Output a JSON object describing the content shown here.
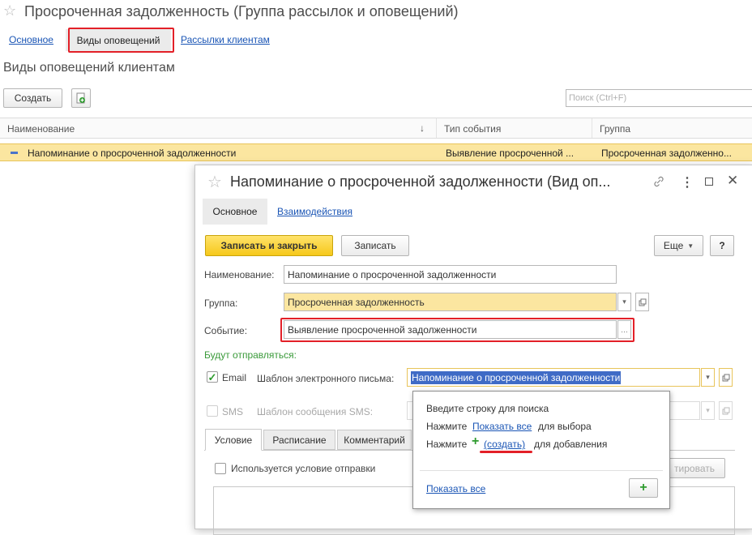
{
  "main": {
    "title": "Просроченная задолженность (Группа рассылок и оповещений)",
    "tabs": [
      "Основное",
      "Виды оповещений",
      "Рассылки клиентам"
    ],
    "section_title": "Виды оповещений клиентам",
    "create_label": "Создать",
    "search_placeholder": "Поиск (Ctrl+F)",
    "columns": [
      "Наименование",
      "Тип события",
      "Группа"
    ],
    "sort_indicator": "↓",
    "rows": [
      {
        "name": "Напоминание о просроченной задолженности",
        "event": "Выявление просроченной ...",
        "group": "Просроченная задолженно..."
      }
    ]
  },
  "dialog": {
    "title": "Напоминание о просроченной задолженности (Вид оп...",
    "tabs": [
      "Основное",
      "Взаимодействия"
    ],
    "save_close_label": "Записать и закрыть",
    "save_label": "Записать",
    "more_label": "Еще",
    "help_label": "?",
    "name_label": "Наименование:",
    "name_value": "Напоминание о просроченной задолженности",
    "group_label": "Группа:",
    "group_value": "Просроченная задолженность",
    "event_label": "Событие:",
    "event_value": "Выявление просроченной задолженности",
    "will_send_label": "Будут отправляться:",
    "email_label": "Email",
    "email_template_label": "Шаблон электронного письма:",
    "email_template_value": "Напоминание о просроченной задолженности",
    "sms_label": "SMS",
    "sms_template_label": "Шаблон сообщения SMS:",
    "inner_tabs": [
      "Условие",
      "Расписание",
      "Комментарий"
    ],
    "condition_label": "Используется условие отправки",
    "edit_button_partial": "тировать"
  },
  "popup": {
    "line1": "Введите строку для поиска",
    "line2_prefix": "Нажмите",
    "line2_link": "Показать все",
    "line2_suffix": "для выбора",
    "line3_prefix": "Нажмите",
    "line3_link": "(создать)",
    "line3_suffix": "для добавления",
    "show_all_link": "Показать все"
  },
  "colors": {
    "accent_yellow": "#f6c81a",
    "highlight_red": "#e32028",
    "link_blue": "#1a55b5",
    "green_label": "#3a9a3a"
  }
}
